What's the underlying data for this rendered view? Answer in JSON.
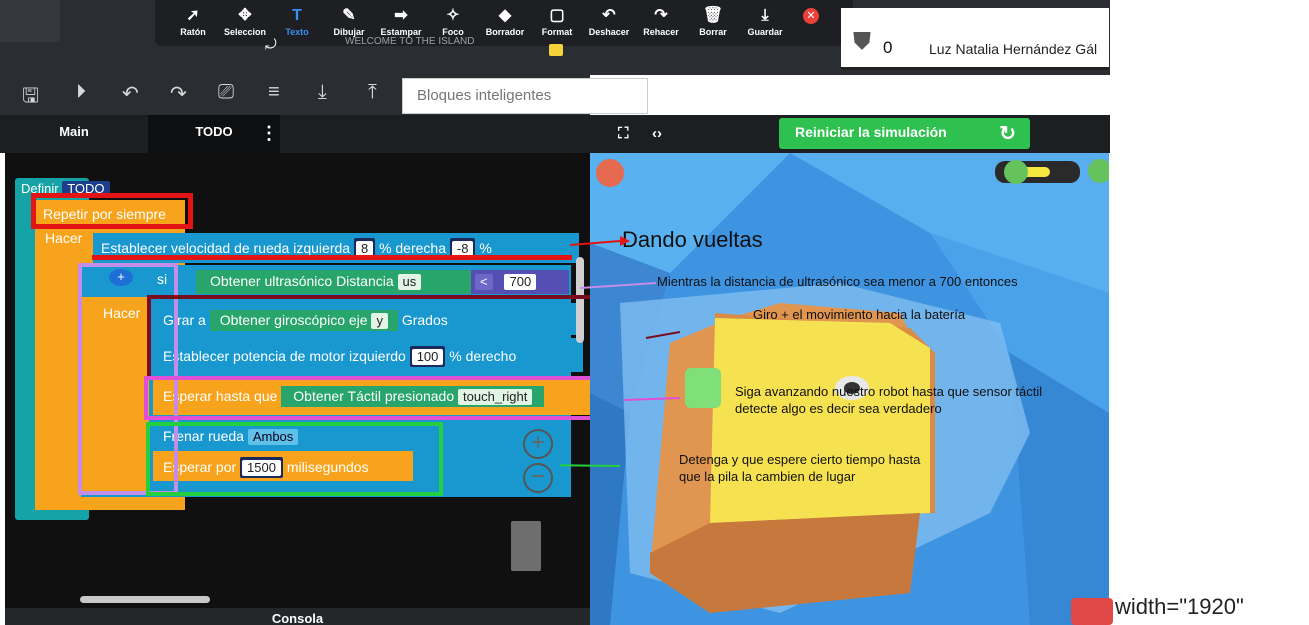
{
  "annotation_toolbar": {
    "tools": [
      {
        "label": "Ratón",
        "icon": "cursor-icon",
        "glyph": "➚",
        "active": false
      },
      {
        "label": "Seleccion",
        "icon": "move-icon",
        "glyph": "✥",
        "active": false
      },
      {
        "label": "Texto",
        "icon": "text-icon",
        "glyph": "T",
        "active": true
      },
      {
        "label": "Dibujar",
        "icon": "pen-icon",
        "glyph": "✎",
        "active": false
      },
      {
        "label": "Estampar",
        "icon": "arrow-stamp-icon",
        "glyph": "➡",
        "active": false
      },
      {
        "label": "Foco",
        "icon": "spotlight-icon",
        "glyph": "✧",
        "active": false
      },
      {
        "label": "Borrador",
        "icon": "eraser-icon",
        "glyph": "◆",
        "active": false
      },
      {
        "label": "Format",
        "icon": "format-icon",
        "glyph": "▢",
        "active": false
      },
      {
        "label": "Deshacer",
        "icon": "undo-icon",
        "glyph": "↶",
        "active": false
      },
      {
        "label": "Rehacer",
        "icon": "redo-icon",
        "glyph": "↷",
        "active": false
      },
      {
        "label": "Borrar",
        "icon": "trash-icon",
        "glyph": "🗑",
        "active": false
      },
      {
        "label": "Guardar",
        "icon": "save-icon",
        "glyph": "⤓",
        "active": false
      }
    ],
    "close_glyph": "✕",
    "active_color": "#3a8ef6"
  },
  "world": {
    "title": "WELCOME TO THE ISLAND"
  },
  "user": {
    "score": "0",
    "name": "Luz Natalia Hernández Gál"
  },
  "editor_toolbar": {
    "search_placeholder": "Bloques inteligentes"
  },
  "tabs": [
    {
      "label": "Main"
    },
    {
      "label": "TODO"
    }
  ],
  "blocks": {
    "define": "Definir",
    "define_name": "TODO",
    "forever": "Repetir por siempre",
    "do1": "Hacer",
    "set_speed": "Establecer velocidad de rueda  izquierda",
    "left_val": "8",
    "pct_right": "%  derecha",
    "right_val": "-8",
    "pct": "%",
    "if": "si",
    "get_ultra": "Obtener ultrasónico  Distancia",
    "sensor": "us",
    "op": "<",
    "thresh": "700",
    "do2": "Hacer",
    "turn": "Girar a",
    "get_gyro": "Obtener giroscópico eje",
    "axis": "y",
    "degrees": "Grados",
    "set_power": "Establecer potencia de motor  izquierdo",
    "power_val": "100",
    "power_right": "%  derecho",
    "wait_until": "Esperar hasta que",
    "get_touch": "Obtener  Táctil presionado",
    "touch": "touch_right",
    "brake": "Frenar rueda",
    "brake_opt": "Ambos",
    "wait_for": "Esperar por",
    "ms_val": "1500",
    "ms": "milisegundos"
  },
  "simulation": {
    "reset_label": "Reiniciar la simulación"
  },
  "annotations": {
    "a1": "Dando vueltas",
    "a2": "Mientras la distancia de ultrasónico sea menor a 700 entonces",
    "a3": "Giro + el movimiento hacia la batería",
    "a4_line1": "Siga avanzando nuestro robot hasta que sensor táctil",
    "a4_line2": "detecte algo es decir sea verdadero",
    "a5_line1": "Detenga y que espere cierto tiempo hasta",
    "a5_line2": "que la pila la cambien de lugar"
  },
  "console_label": "Consola",
  "stray_text": "width=\"1920\""
}
